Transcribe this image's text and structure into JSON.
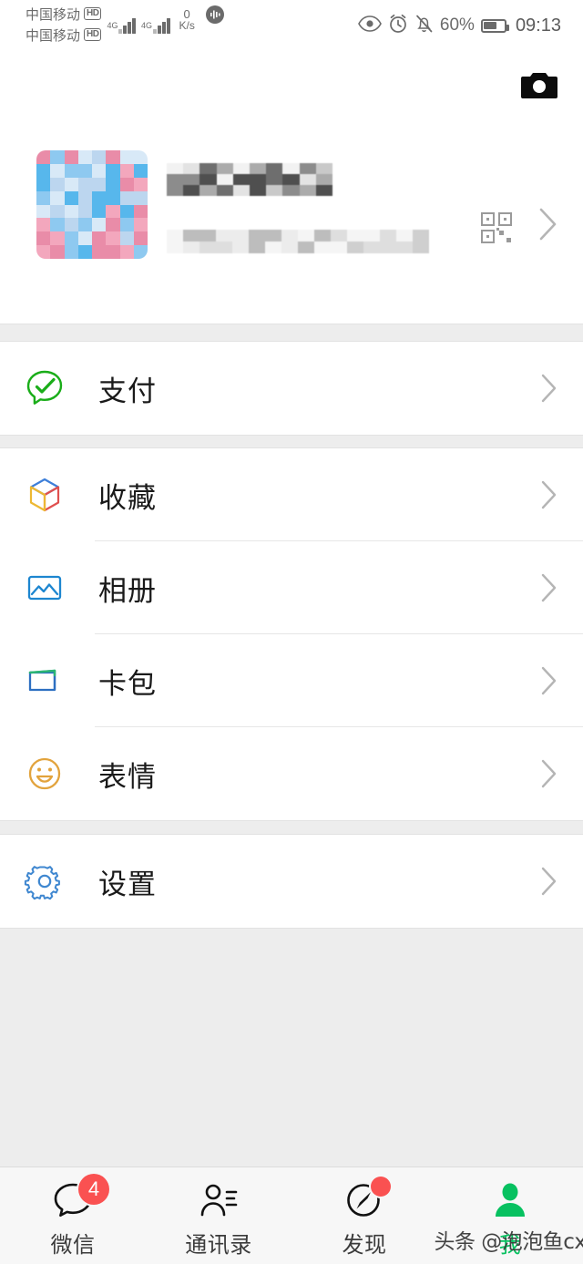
{
  "status_bar": {
    "carrier_primary": "中国移动",
    "carrier_secondary": "中国移动",
    "hd_badge": "HD",
    "network_type_sim1": "4G",
    "network_type_sim2": "4G",
    "net_speed_value": "0",
    "net_speed_unit": "K/s",
    "battery_percent": "60%",
    "clock": "09:13",
    "icons": [
      "eye-icon",
      "alarm-clock-icon",
      "bell-muted-icon",
      "battery-icon",
      "sound-wave-icon"
    ]
  },
  "header": {
    "camera_icon": "camera-icon"
  },
  "profile": {
    "avatar_alt": "blurred-avatar",
    "display_name": "",
    "wechat_id": "",
    "qr_icon": "qr-code-icon",
    "chevron": "chevron-right-icon",
    "avatar_colors": [
      "#57b7ec",
      "#8ec9f0",
      "#f3a7bd",
      "#e98ca8",
      "#bcd6ef",
      "#d8e9f7"
    ],
    "name_blur_colors": [
      "#4f4f4f",
      "#6e6e6e",
      "#8c8c8c",
      "#ababab",
      "#c9c9c9",
      "#e3e3e3",
      "#f2f2f2"
    ],
    "id_blur_colors": [
      "#bdbdbd",
      "#cfcfcf",
      "#dedede",
      "#ececec",
      "#f5f5f5"
    ]
  },
  "sections": [
    {
      "id": "pay",
      "rows": [
        {
          "label": "支付",
          "icon": "wechat-pay-icon",
          "color": "#1aad19",
          "chevron": "chevron-right-icon"
        }
      ]
    },
    {
      "id": "personal",
      "rows": [
        {
          "label": "收藏",
          "icon": "favorites-cube-icon",
          "color": "#3d7fd9",
          "chevron": "chevron-right-icon"
        },
        {
          "label": "相册",
          "icon": "album-photo-icon",
          "color": "#1d86d0",
          "chevron": "chevron-right-icon"
        },
        {
          "label": "卡包",
          "icon": "card-wallet-icon",
          "color": "#2d6fc1",
          "chevron": "chevron-right-icon"
        },
        {
          "label": "表情",
          "icon": "sticker-smiley-icon",
          "color": "#e2a33c",
          "chevron": "chevron-right-icon"
        }
      ]
    },
    {
      "id": "settings",
      "rows": [
        {
          "label": "设置",
          "icon": "gear-icon",
          "color": "#3f87d0",
          "chevron": "chevron-right-icon"
        }
      ]
    }
  ],
  "tabbar": {
    "tabs": [
      {
        "label": "微信",
        "icon": "chat-bubble-icon",
        "badge": "4",
        "dot": false,
        "active": false
      },
      {
        "label": "通讯录",
        "icon": "contacts-icon",
        "badge": "",
        "dot": false,
        "active": false
      },
      {
        "label": "发现",
        "icon": "compass-icon",
        "badge": "",
        "dot": true,
        "active": false
      },
      {
        "label": "我",
        "icon": "person-icon",
        "badge": "",
        "dot": false,
        "active": true
      }
    ],
    "active_color": "#07c160",
    "badge_color": "#fa5151"
  },
  "watermark": {
    "text": "头条 @泡泡鱼cx"
  }
}
